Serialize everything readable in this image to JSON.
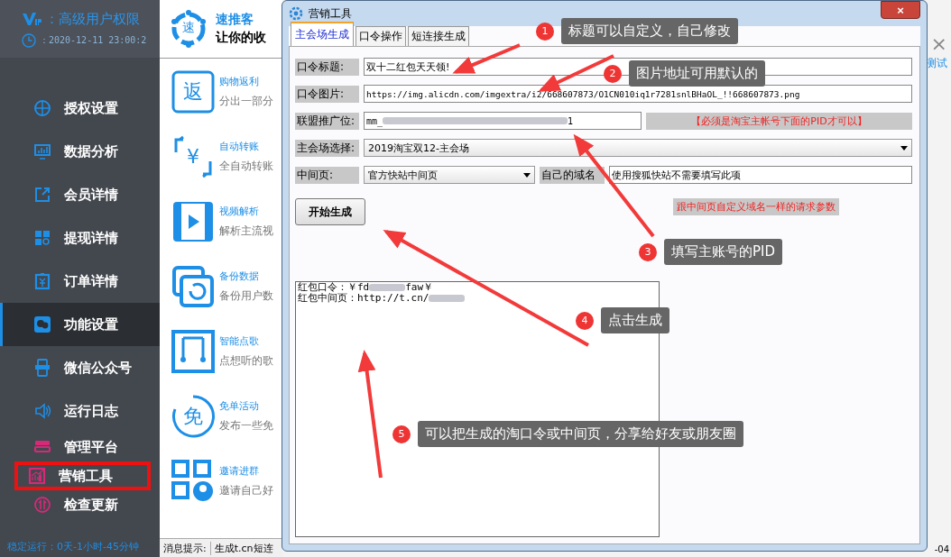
{
  "sidebar": {
    "vip_label": "：高级用户权限",
    "clock_label": "：2020-12-11 23:00:2",
    "items": [
      {
        "label": "授权设置",
        "selected": false,
        "highlighted": false,
        "color": "#1e8fe6"
      },
      {
        "label": "数据分析",
        "selected": false,
        "highlighted": false,
        "color": "#1e8fe6"
      },
      {
        "label": "会员详情",
        "selected": false,
        "highlighted": false,
        "color": "#1e8fe6"
      },
      {
        "label": "提现详情",
        "selected": false,
        "highlighted": false,
        "color": "#1e8fe6"
      },
      {
        "label": "订单详情",
        "selected": false,
        "highlighted": false,
        "color": "#1e8fe6"
      },
      {
        "label": "功能设置",
        "selected": true,
        "highlighted": false,
        "color": "#1e8fe6"
      },
      {
        "label": "微信公众号",
        "selected": false,
        "highlighted": false,
        "color": "#1e8fe6"
      },
      {
        "label": "运行日志",
        "selected": false,
        "highlighted": false,
        "color": "#1e8fe6"
      },
      {
        "label": "管理平台",
        "selected": false,
        "highlighted": false,
        "color": "#d42a78"
      },
      {
        "label": "营销工具",
        "selected": false,
        "highlighted": true,
        "color": "#d42a78"
      },
      {
        "label": "检查更新",
        "selected": false,
        "highlighted": false,
        "color": "#d42a78"
      }
    ],
    "uptime": "稳定运行：0天-1小时-45分钟"
  },
  "header": {
    "logo_text": "速",
    "title": "速推客",
    "slogan": "让你的收"
  },
  "features": [
    {
      "icon_text": "返",
      "title": "购物返利",
      "desc": "分出一部分"
    },
    {
      "icon_text": "¥",
      "title": "自动转账",
      "desc": "全自动转账"
    },
    {
      "title": "视频解析",
      "desc": "解析主流视"
    },
    {
      "title": "备份数据",
      "desc": "备份用户数"
    },
    {
      "title": "智能点歌",
      "desc": "点想听的歌"
    },
    {
      "icon_text": "免",
      "title": "免单活动",
      "desc": "发布一些免"
    },
    {
      "title": "邀请进群",
      "desc": "邀请自己好"
    }
  ],
  "status_bar": {
    "label": "消息提示:",
    "message": "生成t.cn短连"
  },
  "background": {
    "close": "×",
    "test_link": "测试",
    "date_tail": "-04"
  },
  "dialog": {
    "title": "营销工具",
    "close": "×",
    "tabs": [
      {
        "label": "主会场生成",
        "selected": true
      },
      {
        "label": "口令操作",
        "selected": false
      },
      {
        "label": "短连接生成",
        "selected": false
      }
    ],
    "title_field": {
      "label": "口令标题:",
      "value": "双十二红包天天领!"
    },
    "image_field": {
      "label": "口令图片:",
      "value": "https://img.alicdn.com/imgextra/i2/668607873/O1CN010iq1r7281snlBHaOL_!!668607873.png"
    },
    "pid_field": {
      "label": "联盟推广位:",
      "value_start": "mm_",
      "value_end": "1",
      "note": "【必须是淘宝主帐号下面的PID才可以】"
    },
    "venue_select": {
      "label": "主会场选择:",
      "value": "2019淘宝双12-主会场"
    },
    "page_select": {
      "label": "中间页:",
      "value": "官方快站中间页"
    },
    "domain_field": {
      "label": "自己的域名",
      "value": "使用搜狐快站不需要填写此项"
    },
    "generate_button": "开始生成",
    "param_note": "跟中间页自定义域名一样的请求参数",
    "output": [
      {
        "start": "红包口令：￥fd",
        "end": "faw￥"
      },
      {
        "start": "红包中间页：http://t.cn/"
      }
    ]
  },
  "annotations": [
    {
      "number": "1",
      "text": "标题可以自定义，自己修改"
    },
    {
      "number": "2",
      "text": "图片地址可用默认的"
    },
    {
      "number": "3",
      "text": "填写主账号的PID"
    },
    {
      "number": "4",
      "text": "点击生成"
    },
    {
      "number": "5",
      "text": "可以把生成的淘口令或中间页，分享给好友或朋友圈"
    }
  ]
}
